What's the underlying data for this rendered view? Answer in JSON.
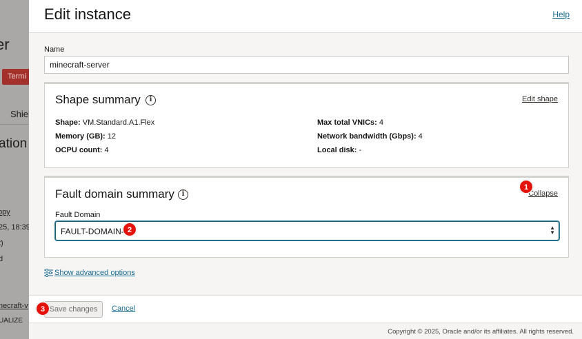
{
  "background": {
    "title_fragment": "er",
    "terminate_fragment": "Termi",
    "tab_fragment": "Shiel",
    "section_fragment": "ation",
    "dot1": ".",
    "link_fragment": "ppy",
    "date_fragment": "25, 18:39",
    "t_fragment": "t)",
    "d_fragment": "d",
    "dot2": ".",
    "instance_link_fragment": "necraft-v",
    "ual_fragment": "UALIZE"
  },
  "panel": {
    "title": "Edit instance",
    "help": "Help"
  },
  "name_field": {
    "label": "Name",
    "value": "minecraft-server"
  },
  "shape_summary": {
    "title": "Shape summary",
    "edit_link": "Edit shape",
    "items": [
      {
        "key": "Shape:",
        "value": "VM.Standard.A1.Flex"
      },
      {
        "key": "Memory (GB):",
        "value": "12"
      },
      {
        "key": "OCPU count:",
        "value": "4"
      },
      {
        "key": "Max total VNICs:",
        "value": "4"
      },
      {
        "key": "Network bandwidth (Gbps):",
        "value": "4"
      },
      {
        "key": "Local disk:",
        "value": "-"
      }
    ]
  },
  "fault_domain": {
    "title": "Fault domain summary",
    "collapse_link": "Collapse",
    "label": "Fault Domain",
    "selected": "FAULT-DOMAIN-1"
  },
  "advanced": {
    "label": "Show advanced options"
  },
  "footer": {
    "save_label": "Save changes",
    "cancel_label": "Cancel",
    "copyright": "Copyright © 2025, Oracle and/or its affiliates. All rights reserved."
  },
  "annotations": [
    "1",
    "2",
    "3"
  ],
  "colors": {
    "accent_link": "#1a6c8f",
    "badge": "#e3120b",
    "terminate": "#a3302a"
  }
}
